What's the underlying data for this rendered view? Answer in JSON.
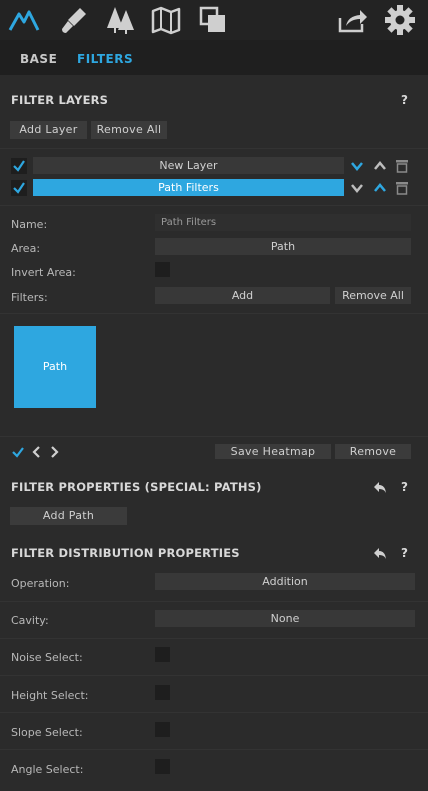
{
  "tabs": {
    "base": "BASE",
    "filters": "FILTERS"
  },
  "toolbar_icons": [
    "terrain-icon",
    "brush-icon",
    "trees-icon",
    "map-icon",
    "layers-icon",
    "share-icon",
    "gear-icon"
  ],
  "filter_layers": {
    "title": "FILTER LAYERS",
    "help": "?",
    "add_layer": "Add Layer",
    "remove_all": "Remove All",
    "layers": [
      {
        "name": "New Layer",
        "checked": true,
        "selected": false
      },
      {
        "name": "Path Filters",
        "checked": true,
        "selected": true
      }
    ]
  },
  "layer_props": {
    "name_label": "Name:",
    "name_value": "Path Filters",
    "area_label": "Area:",
    "area_value": "Path",
    "invert_label": "Invert Area:",
    "filters_label": "Filters:",
    "filters_add": "Add",
    "filters_remove_all": "Remove All"
  },
  "preview": {
    "thumb_label": "Path",
    "save_heatmap": "Save Heatmap",
    "remove": "Remove"
  },
  "filter_properties": {
    "title": "FILTER PROPERTIES (SPECIAL: PATHS)",
    "help": "?",
    "add_path": "Add Path"
  },
  "distribution": {
    "title": "FILTER DISTRIBUTION PROPERTIES",
    "help": "?",
    "operation_label": "Operation:",
    "operation_value": "Addition",
    "cavity_label": "Cavity:",
    "cavity_value": "None",
    "noise_label": "Noise Select:",
    "height_label": "Height Select:",
    "slope_label": "Slope Select:",
    "angle_label": "Angle Select:"
  },
  "colors": {
    "accent": "#2ea7e0",
    "bg": "#2b2b2b",
    "topbar": "#232323"
  }
}
